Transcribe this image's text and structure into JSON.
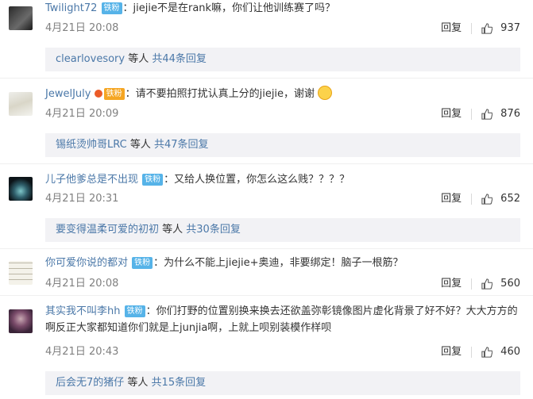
{
  "comments": [
    {
      "username": "Twilight72",
      "badge": "铁粉",
      "text": "：jiejie不是在rank嘛，你们让他训练赛了吗？",
      "time": "4月21日 20:08",
      "reply_label": "回复",
      "likes": "937",
      "reply_user": "clearlovesory",
      "reply_mid": " 等人 ",
      "reply_count": "共44条回复"
    },
    {
      "username": "JewelJuly",
      "badge": "铁粉",
      "text": "：请不要拍照打扰认真上分的jiejie，谢谢",
      "time": "4月21日 20:09",
      "reply_label": "回复",
      "likes": "876",
      "reply_user": "锡纸烫帅哥LRC",
      "reply_mid": " 等人 ",
      "reply_count": "共47条回复"
    },
    {
      "username": "儿子他爹总是不出现",
      "badge": "铁粉",
      "text": "：又给人换位置，你怎么这么贱？？？？",
      "time": "4月21日 20:31",
      "reply_label": "回复",
      "likes": "652",
      "reply_user": "要变得温柔可爱的初初",
      "reply_mid": " 等人 ",
      "reply_count": "共30条回复"
    },
    {
      "username": "你可爱你说的都对",
      "badge": "铁粉",
      "text": "：为什么不能上jiejie+奥迪，非要绑定！脑子一根筋？",
      "time": "4月21日 20:08",
      "reply_label": "回复",
      "likes": "560"
    },
    {
      "username": "其实我不叫李hh",
      "badge": "铁粉",
      "text": "：你们打野的位置别换来换去还欲盖弥彰镜像图片虚化背景了好不好？大大方方的啊反正大家都知道你们就是上junjia啊，上就上呗别装模作样呗",
      "time": "4月21日 20:43",
      "reply_label": "回复",
      "likes": "460",
      "reply_user": "后会无7的猪仔",
      "reply_mid": " 等人 ",
      "reply_count": "共15条回复"
    }
  ]
}
